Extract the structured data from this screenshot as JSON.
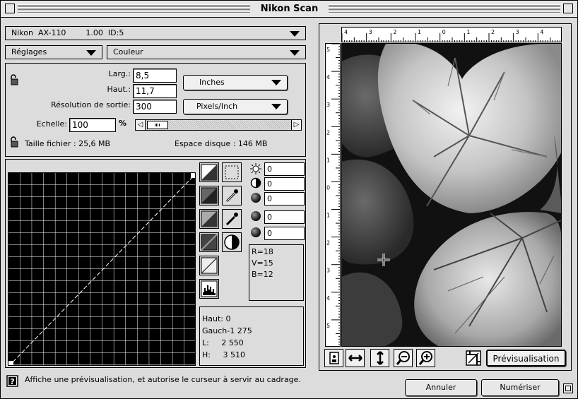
{
  "window": {
    "title": "Nikon Scan"
  },
  "scanner": {
    "label": "Nikon  AX-110        1.00  ID:5"
  },
  "settings": {
    "reglages_label": "Réglages",
    "couleur_label": "Couleur"
  },
  "dimensions": {
    "larg_label": "Larg.:",
    "larg_value": "8,5",
    "haut_label": "Haut.:",
    "haut_value": "11,7",
    "units_label": "Inches",
    "resolution_label": "Résolution de sortie:",
    "resolution_value": "300",
    "res_units_label": "Pixels/Inch",
    "echelle_label": "Echelle:",
    "echelle_value": "100",
    "percent": "%",
    "file_size": "Taille fichier : 25,6 MB",
    "disk_space": "Espace disque : 146 MB"
  },
  "adjustments": {
    "brightness": "0",
    "contrast": "0",
    "red": "0",
    "green": "0",
    "blue": "0"
  },
  "rgb_readout": {
    "r": "R=18",
    "v": "V=15",
    "b": "B=12"
  },
  "selection_readout": {
    "haut": "Haut: 0",
    "gauche": "Gauch-1 275",
    "l": "L:     2 550",
    "h": "H:     3 510"
  },
  "ruler": {
    "top_labels": [
      "4",
      "3",
      "2",
      "1",
      "0",
      "1",
      "2",
      "3",
      "4"
    ],
    "left_labels": [
      "5",
      "4",
      "3",
      "2",
      "1",
      "0",
      "1",
      "2",
      "3",
      "4",
      "5"
    ]
  },
  "buttons": {
    "previsualisation": "Prévisualisation",
    "annuler": "Annuler",
    "numeriser": "Numériser"
  },
  "help_text": "Affiche une prévisualisation, et autorise le curseur à servir au cadrage.",
  "icons": [
    "lock-icon",
    "brightness-icon",
    "contrast-icon",
    "red-channel-icon",
    "green-channel-icon",
    "blue-channel-icon",
    "help-icon",
    "crosshair-cursor-icon",
    "zoom-in-icon",
    "zoom-out-icon",
    "fit-width-icon",
    "fit-height-icon",
    "crop-tool-icon"
  ]
}
